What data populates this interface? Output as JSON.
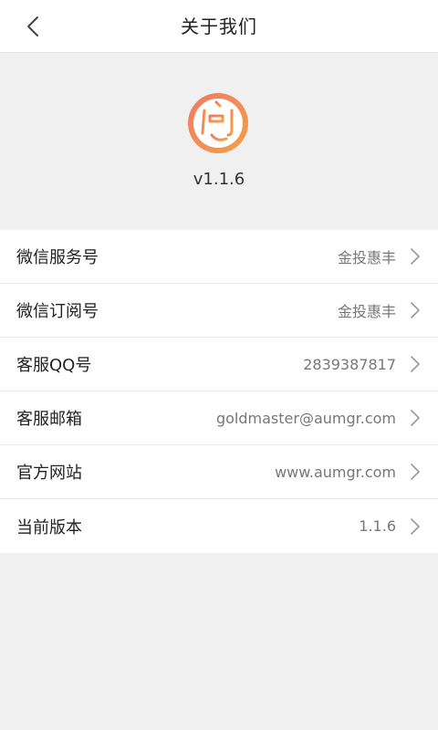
{
  "nav": {
    "title": "关于我们",
    "back_icon": "chevron-left-icon"
  },
  "app": {
    "logo_icon": "app-logo-seal",
    "version": "v1.1.6",
    "accent_color_start": "#f07a62",
    "accent_color_end": "#f39a4a"
  },
  "rows": [
    {
      "label": "微信服务号",
      "value": "金投惠丰"
    },
    {
      "label": "微信订阅号",
      "value": "金投惠丰"
    },
    {
      "label": "客服QQ号",
      "value": "2839387817"
    },
    {
      "label": "客服邮箱",
      "value": "goldmaster@aumgr.com"
    },
    {
      "label": "官方网站",
      "value": "www.aumgr.com"
    },
    {
      "label": "当前版本",
      "value": "1.1.6"
    }
  ]
}
